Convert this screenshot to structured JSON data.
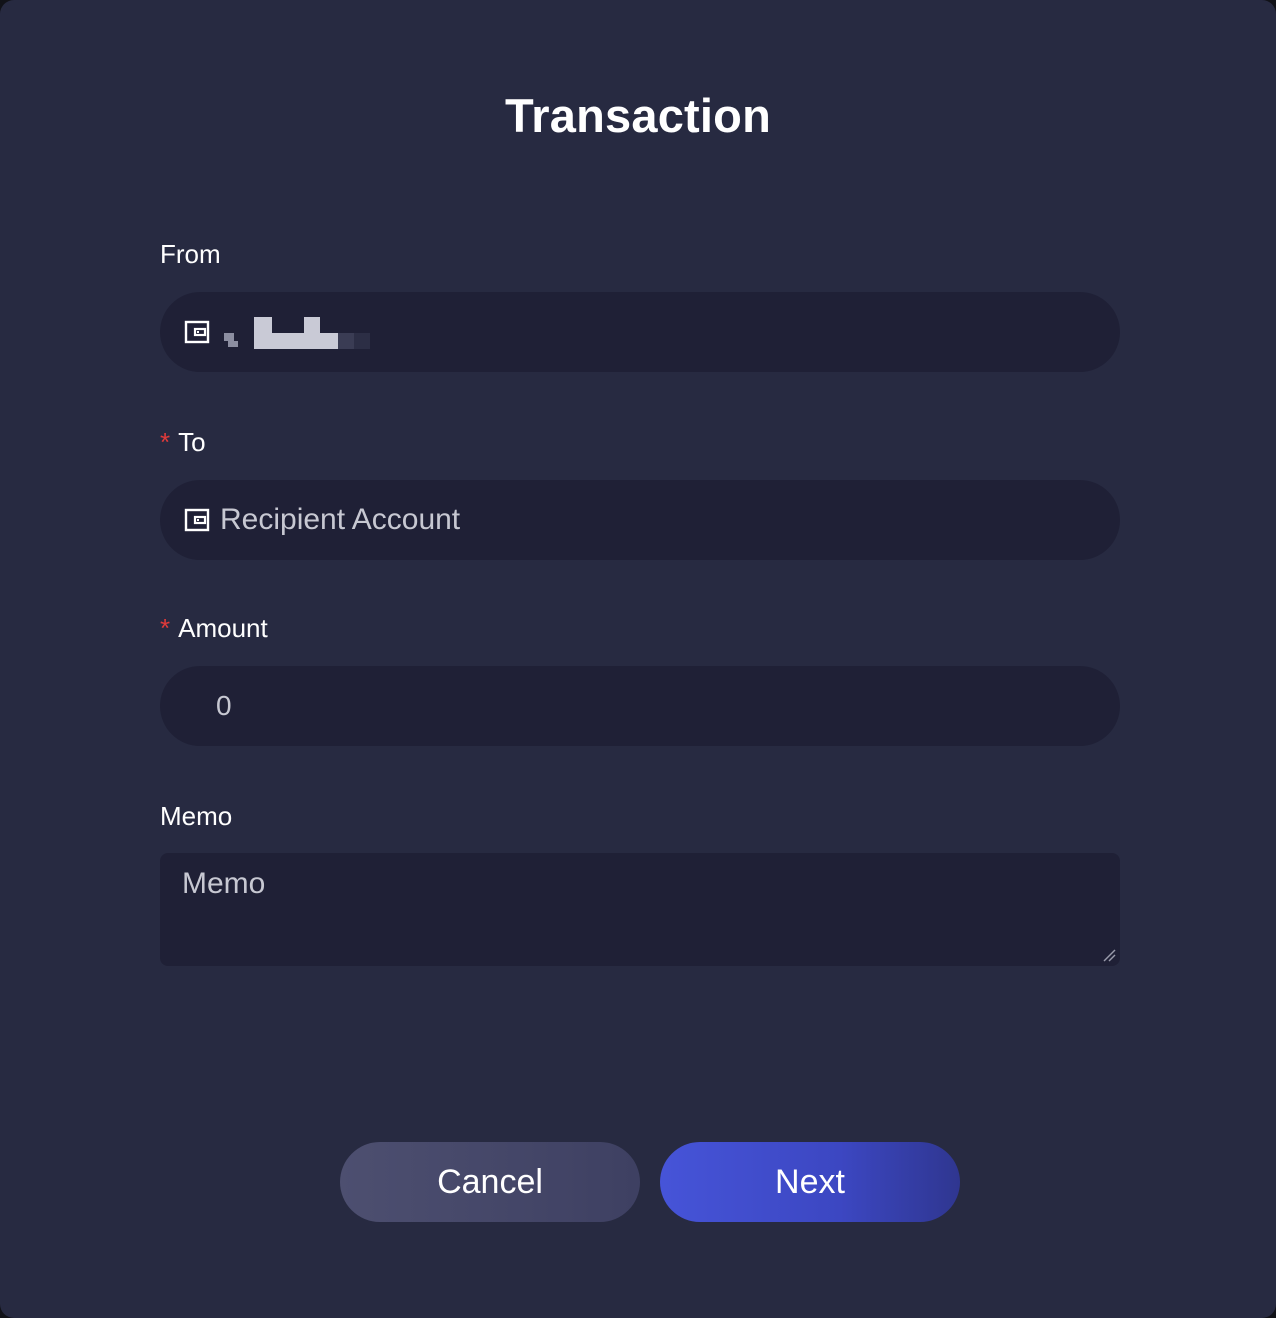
{
  "dialog": {
    "title": "Transaction"
  },
  "form": {
    "from": {
      "label": "From",
      "icon": "wallet-icon"
    },
    "to": {
      "label": "To",
      "required_marker": "*",
      "placeholder": "Recipient Account",
      "icon": "wallet-icon"
    },
    "amount": {
      "label": "Amount",
      "required_marker": "*",
      "value": "0"
    },
    "memo": {
      "label": "Memo",
      "placeholder": "Memo"
    }
  },
  "actions": {
    "cancel_label": "Cancel",
    "next_label": "Next"
  },
  "colors": {
    "background": "#272a41",
    "field_background": "#1f2036",
    "required": "#e03a3a",
    "primary": "#4654d8",
    "secondary": "#4d4f70"
  }
}
